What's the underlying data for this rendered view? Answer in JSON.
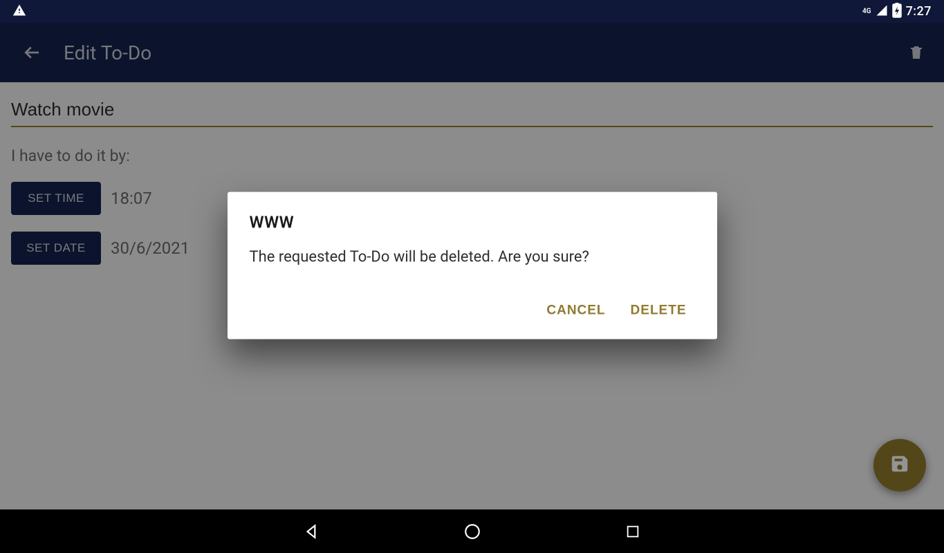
{
  "status": {
    "network": "4G",
    "time": "7:27"
  },
  "appbar": {
    "title": "Edit To-Do"
  },
  "todo": {
    "title_value": "Watch movie",
    "sub_label": "I have to do it by:",
    "set_time_label": "SET TIME",
    "time_value": "18:07",
    "set_date_label": "SET DATE",
    "date_value": "30/6/2021"
  },
  "dialog": {
    "title": "WWW",
    "message": "The requested To-Do will be deleted. Are you sure?",
    "cancel_label": "CANCEL",
    "delete_label": "DELETE"
  }
}
